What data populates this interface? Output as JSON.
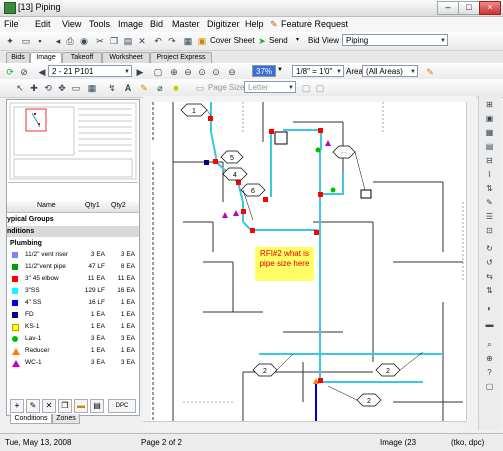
{
  "window": {
    "title": "[13] Piping"
  },
  "menu": [
    "File",
    "Edit",
    "View",
    "Tools",
    "Image",
    "Bid",
    "Master",
    "Digitizer",
    "Help",
    "Feature Request"
  ],
  "toolbar1": {
    "cover_sheet": "Cover Sheet",
    "send": "Send",
    "bid_view_label": "Bid View",
    "bid_view_value": "Piping"
  },
  "tabs": [
    "Bids",
    "Image",
    "Takeoff",
    "Worksheet",
    "Project Express"
  ],
  "toolbar2": {
    "page": "2 - 21 P101",
    "zoom": "37%",
    "scale": "1/8\" = 1'0\"",
    "area_label": "Area",
    "area_value": "(All Areas)"
  },
  "toolbar3": {
    "page_size_label": "Page Size",
    "page_size_value": "Letter"
  },
  "grid": {
    "headers": [
      "Name",
      "Qty1",
      "Qty2"
    ],
    "groups": [
      "ypical Groups",
      "nditions",
      "Plumbing"
    ],
    "rows": [
      {
        "name": "11/2\" vent riser",
        "q1": "3 EA",
        "q2": "3 EA",
        "color": "#8080ff"
      },
      {
        "name": "11/2\"vent pipe",
        "q1": "47 LF",
        "q2": "8 EA",
        "color": "#00a000"
      },
      {
        "name": "3\" 45 elbow",
        "q1": "11 EA",
        "q2": "11 EA",
        "color": "#ff0000"
      },
      {
        "name": "3\"SS",
        "q1": "129 LF",
        "q2": "16 EA",
        "color": "#00ffff"
      },
      {
        "name": "4\" SS",
        "q1": "16 LF",
        "q2": "1 EA",
        "color": "#0000ff"
      },
      {
        "name": "FD",
        "q1": "1 EA",
        "q2": "1 EA",
        "color": "#000080"
      },
      {
        "name": "KS-1",
        "q1": "1 EA",
        "q2": "1 EA",
        "color": "#ffff00"
      },
      {
        "name": "Lav-1",
        "q1": "3 EA",
        "q2": "3 EA",
        "color": "#00c000"
      },
      {
        "name": "Reducer",
        "q1": "1 EA",
        "q2": "1 EA",
        "color": "#ff8000"
      },
      {
        "name": "WC-1",
        "q1": "3 EA",
        "q2": "3 EA",
        "color": "#c000c0"
      }
    ]
  },
  "bottom_tabs": [
    "Conditions",
    "Zones"
  ],
  "bottom_button": "DPC",
  "note": {
    "line1": "RFI#2 what is",
    "line2": "pipe size here"
  },
  "tags": [
    "1",
    "4",
    "5",
    "6",
    "2",
    "2",
    "2"
  ],
  "status": {
    "date": "Tue, May 13, 2008",
    "page": "Page 2 of 2",
    "image": "Image (23",
    "user": "(tko, dpc)"
  }
}
